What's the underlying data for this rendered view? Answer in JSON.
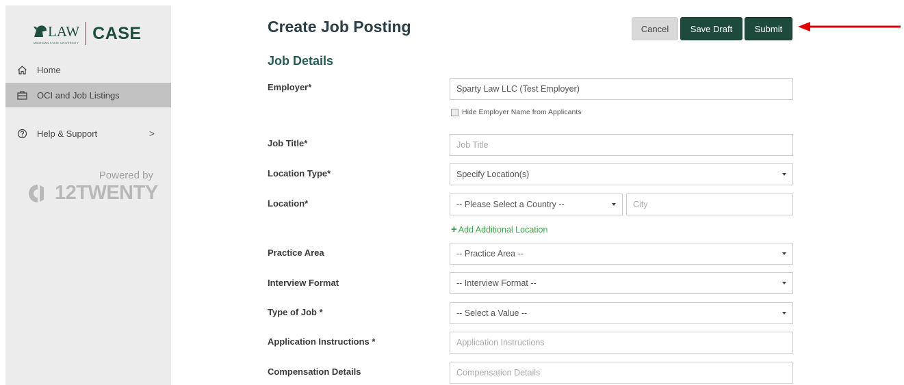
{
  "sidebar": {
    "logo": {
      "law": "LAW",
      "university": "MICHIGAN STATE UNIVERSITY",
      "case": "CASE"
    },
    "items": [
      {
        "label": "Home",
        "icon": "home-icon"
      },
      {
        "label": "OCI and Job Listings",
        "icon": "briefcase-icon",
        "active": true
      },
      {
        "label": "Help & Support",
        "icon": "help-icon",
        "chevron": ">"
      }
    ],
    "powered_by": "Powered by",
    "brand": "12TWENTY"
  },
  "header": {
    "title": "Create Job Posting",
    "cancel_label": "Cancel",
    "save_draft_label": "Save Draft",
    "submit_label": "Submit",
    "accent": "#1d4a3d",
    "arrow_color": "#e00000"
  },
  "form": {
    "section_title": "Job Details",
    "employer": {
      "label": "Employer*",
      "value": "Sparty Law LLC (Test Employer)",
      "hide_label": "Hide Employer Name from Applicants"
    },
    "job_title": {
      "label": "Job Title*",
      "placeholder": "Job Title"
    },
    "location_type": {
      "label": "Location Type*",
      "value": "Specify Location(s)"
    },
    "location": {
      "label": "Location*",
      "country": "-- Please Select a Country --",
      "city_placeholder": "City",
      "add_label": "Add Additional Location"
    },
    "practice_area": {
      "label": "Practice Area",
      "value": "-- Practice Area --"
    },
    "interview_format": {
      "label": "Interview Format",
      "value": "-- Interview Format --"
    },
    "job_type": {
      "label": "Type of Job *",
      "value": "-- Select a Value --"
    },
    "application_instructions": {
      "label": "Application Instructions *",
      "placeholder": "Application Instructions"
    },
    "compensation": {
      "label": "Compensation Details",
      "placeholder": "Compensation Details"
    }
  }
}
